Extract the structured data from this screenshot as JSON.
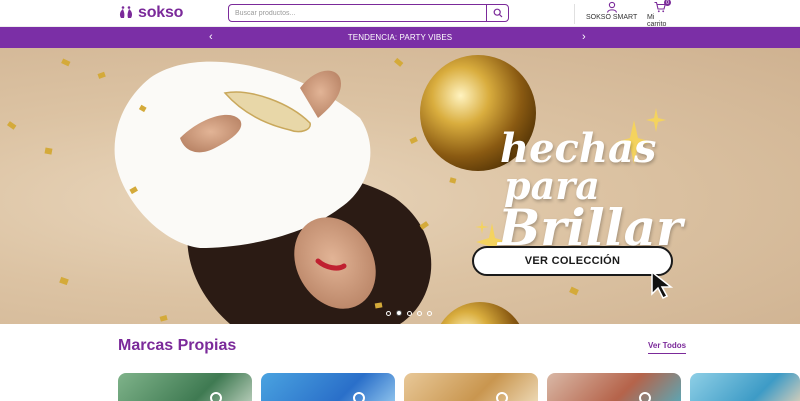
{
  "header": {
    "logo_text": "sokso",
    "search": {
      "placeholder": "Buscar productos..."
    },
    "account_label": "SOKSO SMART",
    "cart_label": "Mi carrito",
    "cart_count": "0"
  },
  "promo": {
    "text": "TENDENCIA: PARTY VIBES"
  },
  "hero": {
    "slogan": [
      "hechas",
      "para",
      "Brillar"
    ],
    "cta_label": "VER COLECCIÓN",
    "slides": 5,
    "active_slide": 2
  },
  "brands": {
    "title": "Marcas Propias",
    "see_all": "Ver Todos"
  },
  "colors": {
    "brand": "#7b2a9a",
    "promo_bg": "#7b2fa6"
  }
}
